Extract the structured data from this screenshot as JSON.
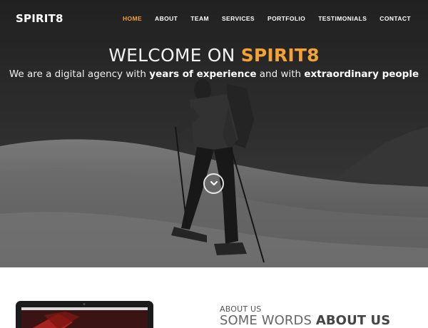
{
  "header": {
    "logo": "SPIRIT8",
    "nav": [
      {
        "label": "HOME",
        "active": true
      },
      {
        "label": "ABOUT",
        "active": false
      },
      {
        "label": "TEAM",
        "active": false
      },
      {
        "label": "SERVICES",
        "active": false
      },
      {
        "label": "PORTFOLIO",
        "active": false
      },
      {
        "label": "TESTIMONIALS",
        "active": false
      },
      {
        "label": "CONTACT",
        "active": false
      }
    ]
  },
  "hero": {
    "welcome_prefix": "WELCOME ON ",
    "welcome_brand": "SPIRIT8",
    "tagline_1": "We are a digital agency with ",
    "tagline_bold_1": "years of experience",
    "tagline_2": " and with ",
    "tagline_bold_2": "extraordinary people",
    "scroll_icon": "chevron-down-icon"
  },
  "about": {
    "label": "ABOUT US",
    "heading_light": "SOME WORDS ",
    "heading_bold": "ABOUT US"
  },
  "colors": {
    "accent": "#f3a233",
    "hero_dark": "#2a2a2a",
    "text_light": "#ffffff",
    "section_text": "#555555"
  }
}
